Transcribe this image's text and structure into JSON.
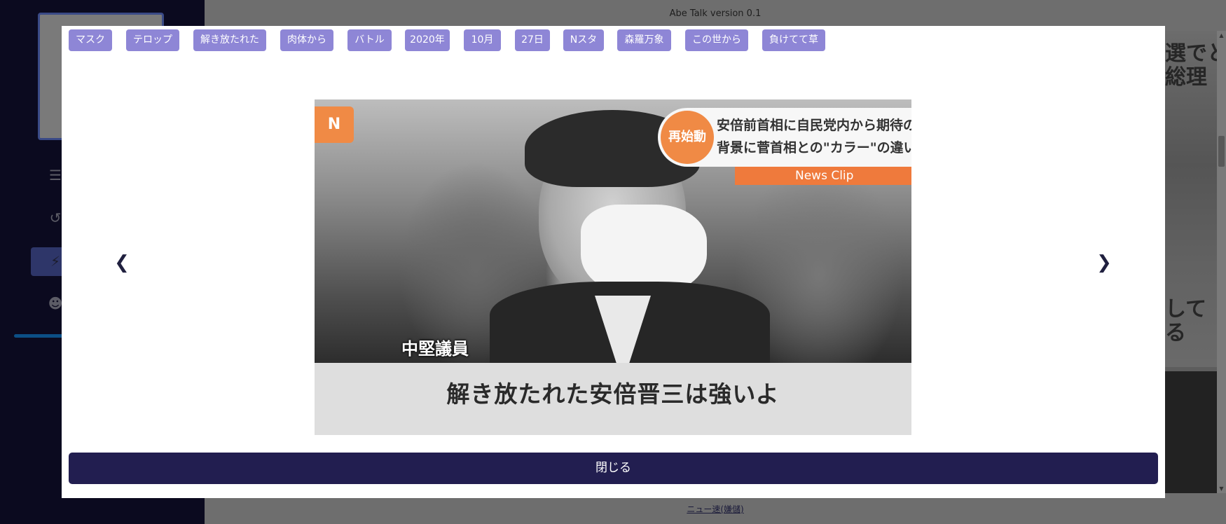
{
  "app": {
    "title": "Abe Talk version 0.1",
    "footer_link": "ニュー速(嫌儲)"
  },
  "sidebar": {
    "icons": [
      "list-icon",
      "history-icon",
      "bolt-icon",
      "smiley-icon"
    ]
  },
  "background_right": {
    "text_top": "選でと\n総理",
    "text_bottom": "して\nる"
  },
  "modal": {
    "tags": [
      "マスク",
      "テロップ",
      "解き放たれた",
      "肉体から",
      "バトル",
      "2020年",
      "10月",
      "27日",
      "Nスタ",
      "森羅万象",
      "この世から",
      "負けてて草"
    ],
    "image": {
      "logo_text": "N",
      "badge_text": "再始動",
      "headline_line1": "安倍前首相に自民党内から期待の声?",
      "headline_line2": "背景に菅首相との\"カラー\"の違い",
      "segment_label": "News Clip",
      "speaker_label": "中堅議員",
      "subtitle": "解き放たれた安倍晋三は強いよ"
    },
    "prev_icon": "chevron-left-icon",
    "next_icon": "chevron-right-icon",
    "close_label": "閉じる"
  },
  "colors": {
    "tag_bg": "#8e86d6",
    "close_bg": "#221e50",
    "sidebar_bg": "#0b0a1f",
    "accent_orange": "#f08a45"
  }
}
